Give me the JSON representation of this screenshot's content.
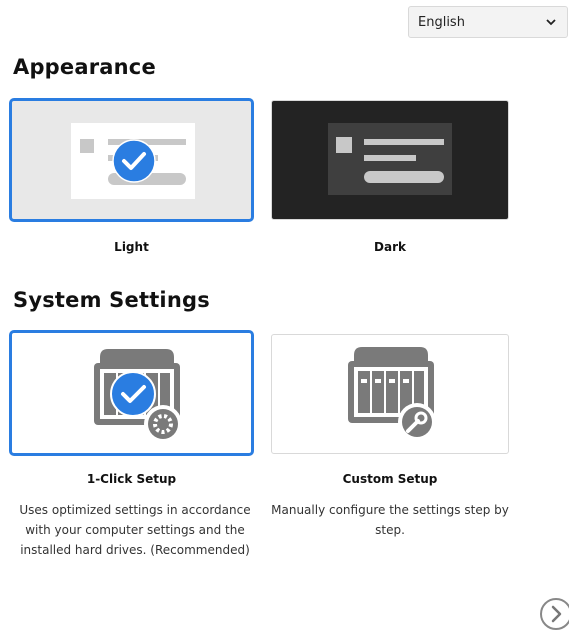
{
  "language": {
    "selected": "English"
  },
  "appearance": {
    "title": "Appearance",
    "options": [
      {
        "label": "Light",
        "selected": true
      },
      {
        "label": "Dark",
        "selected": false
      }
    ]
  },
  "system_settings": {
    "title": "System Settings",
    "options": [
      {
        "label": "1-Click Setup",
        "description": "Uses optimized settings in accordance with your computer settings and the installed hard drives. (Recommended)",
        "selected": true
      },
      {
        "label": "Custom Setup",
        "description": "Manually configure the settings step by step.",
        "selected": false
      }
    ]
  },
  "colors": {
    "accent": "#2a7de1",
    "dark_preview": "#232323",
    "icon_gray": "#7a7a7a"
  },
  "icons": {
    "next": "chevron-right-circle-icon",
    "check": "checkmark-icon",
    "gear": "gear-icon",
    "wrench": "wrench-icon"
  }
}
